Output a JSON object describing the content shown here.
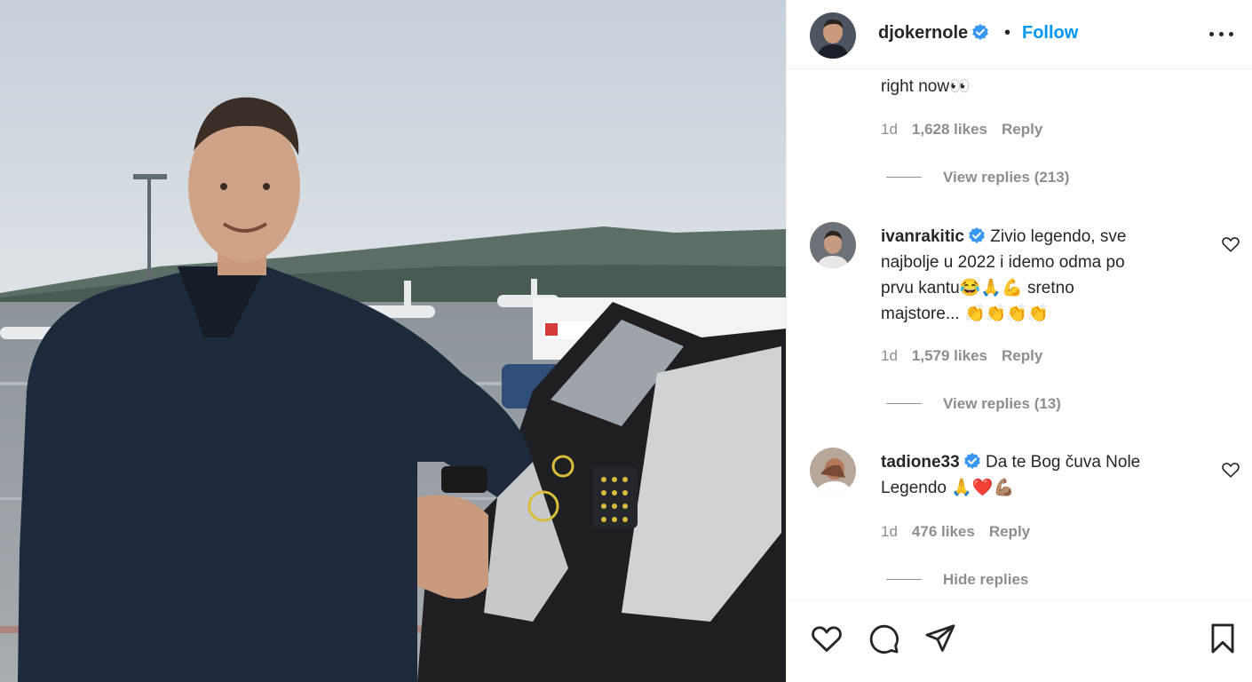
{
  "post": {
    "author": "djokernole",
    "dot": "•",
    "follow_label": "Follow",
    "icons": {
      "more": "more-options-icon",
      "verified": "verified-badge-icon",
      "like": "heart-icon",
      "comment": "comment-icon",
      "share": "share-icon",
      "save": "bookmark-icon"
    },
    "colors": {
      "follow": "#0095f6",
      "verified": "#3897f0",
      "muted": "#8e8e8e"
    }
  },
  "comments": [
    {
      "text": "right now👀",
      "age": "1d",
      "likes": "1,628 likes",
      "reply": "Reply",
      "replies_toggle": "View replies (213)"
    },
    {
      "username": "ivanrakitic",
      "text_lines": [
        "Zivio legendo, sve",
        "najbolje u 2022 i idemo odma po",
        "prvu kantu😂🙏💪 sretno",
        "majstore... 👏👏👏👏"
      ],
      "age": "1d",
      "likes": "1,579 likes",
      "reply": "Reply",
      "replies_toggle": "View replies (13)"
    },
    {
      "username": "tadione33",
      "text_lines": [
        "Da te Bog čuva Nole",
        "Legendo 🙏❤️💪🏽"
      ],
      "age": "1d",
      "likes": "476 likes",
      "reply": "Reply",
      "replies_toggle": "Hide replies"
    }
  ]
}
